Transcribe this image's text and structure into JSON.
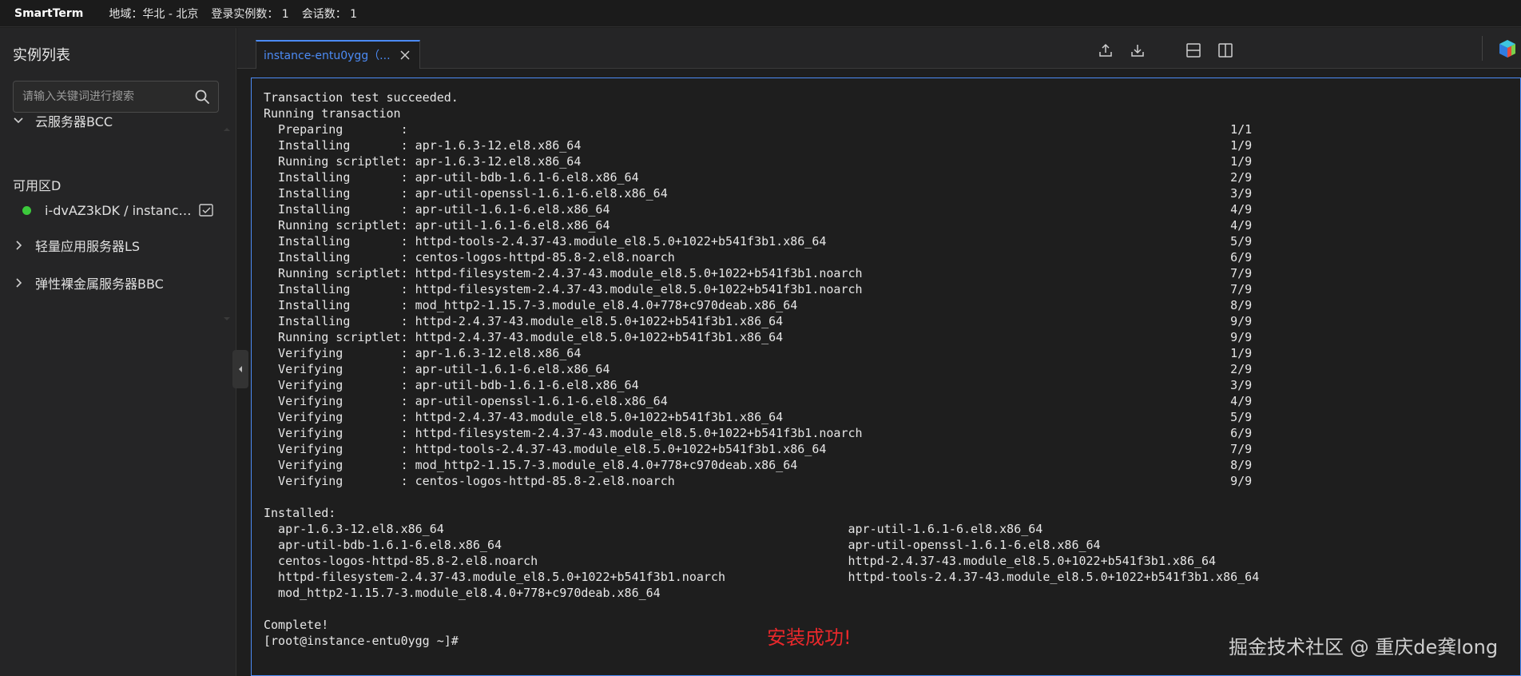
{
  "topbar": {
    "brand": "SmartTerm",
    "region": "地域：华北 - 北京",
    "logged_instances": "登录实例数： 1",
    "sessions": "会话数： 1"
  },
  "sidebar": {
    "title": "实例列表",
    "search_placeholder": "请输入关键词进行搜索",
    "groups": [
      {
        "label": "云服务器BCC",
        "expanded": true
      },
      {
        "label": "轻量应用服务器LS",
        "expanded": false
      },
      {
        "label": "弹性裸金属服务器BBC",
        "expanded": false
      }
    ],
    "zone": "可用区D",
    "instance": {
      "label": "i-dvAZ3kDK / instance...",
      "status_color": "#3cc93c"
    }
  },
  "tab": {
    "label": "instance-entu0ygg（...",
    "accent": "#4c8bf5"
  },
  "terminal": {
    "lines": [
      "Transaction test succeeded.",
      "Running transaction",
      "  Preparing        :                                                                                                                  1/1",
      "  Installing       : apr-1.6.3-12.el8.x86_64                                                                                          1/9",
      "  Running scriptlet: apr-1.6.3-12.el8.x86_64                                                                                          1/9",
      "  Installing       : apr-util-bdb-1.6.1-6.el8.x86_64                                                                                  2/9",
      "  Installing       : apr-util-openssl-1.6.1-6.el8.x86_64                                                                              3/9",
      "  Installing       : apr-util-1.6.1-6.el8.x86_64                                                                                      4/9",
      "  Running scriptlet: apr-util-1.6.1-6.el8.x86_64                                                                                      4/9",
      "  Installing       : httpd-tools-2.4.37-43.module_el8.5.0+1022+b541f3b1.x86_64                                                        5/9",
      "  Installing       : centos-logos-httpd-85.8-2.el8.noarch                                                                             6/9",
      "  Running scriptlet: httpd-filesystem-2.4.37-43.module_el8.5.0+1022+b541f3b1.noarch                                                   7/9",
      "  Installing       : httpd-filesystem-2.4.37-43.module_el8.5.0+1022+b541f3b1.noarch                                                   7/9",
      "  Installing       : mod_http2-1.15.7-3.module_el8.4.0+778+c970deab.x86_64                                                            8/9",
      "  Installing       : httpd-2.4.37-43.module_el8.5.0+1022+b541f3b1.x86_64                                                              9/9",
      "  Running scriptlet: httpd-2.4.37-43.module_el8.5.0+1022+b541f3b1.x86_64                                                              9/9",
      "  Verifying        : apr-1.6.3-12.el8.x86_64                                                                                          1/9",
      "  Verifying        : apr-util-1.6.1-6.el8.x86_64                                                                                      2/9",
      "  Verifying        : apr-util-bdb-1.6.1-6.el8.x86_64                                                                                  3/9",
      "  Verifying        : apr-util-openssl-1.6.1-6.el8.x86_64                                                                              4/9",
      "  Verifying        : httpd-2.4.37-43.module_el8.5.0+1022+b541f3b1.x86_64                                                              5/9",
      "  Verifying        : httpd-filesystem-2.4.37-43.module_el8.5.0+1022+b541f3b1.noarch                                                   6/9",
      "  Verifying        : httpd-tools-2.4.37-43.module_el8.5.0+1022+b541f3b1.x86_64                                                        7/9",
      "  Verifying        : mod_http2-1.15.7-3.module_el8.4.0+778+c970deab.x86_64                                                            8/9",
      "  Verifying        : centos-logos-httpd-85.8-2.el8.noarch                                                                             9/9",
      "",
      "Installed:",
      "  apr-1.6.3-12.el8.x86_64                                                        apr-util-1.6.1-6.el8.x86_64",
      "  apr-util-bdb-1.6.1-6.el8.x86_64                                                apr-util-openssl-1.6.1-6.el8.x86_64",
      "  centos-logos-httpd-85.8-2.el8.noarch                                           httpd-2.4.37-43.module_el8.5.0+1022+b541f3b1.x86_64",
      "  httpd-filesystem-2.4.37-43.module_el8.5.0+1022+b541f3b1.noarch                 httpd-tools-2.4.37-43.module_el8.5.0+1022+b541f3b1.x86_64",
      "  mod_http2-1.15.7-3.module_el8.4.0+778+c970deab.x86_64",
      "",
      "Complete!",
      "[root@instance-entu0ygg ~]#"
    ]
  },
  "annotation": "安装成功!",
  "watermark": "掘金技术社区 @ 重庆de龚long"
}
